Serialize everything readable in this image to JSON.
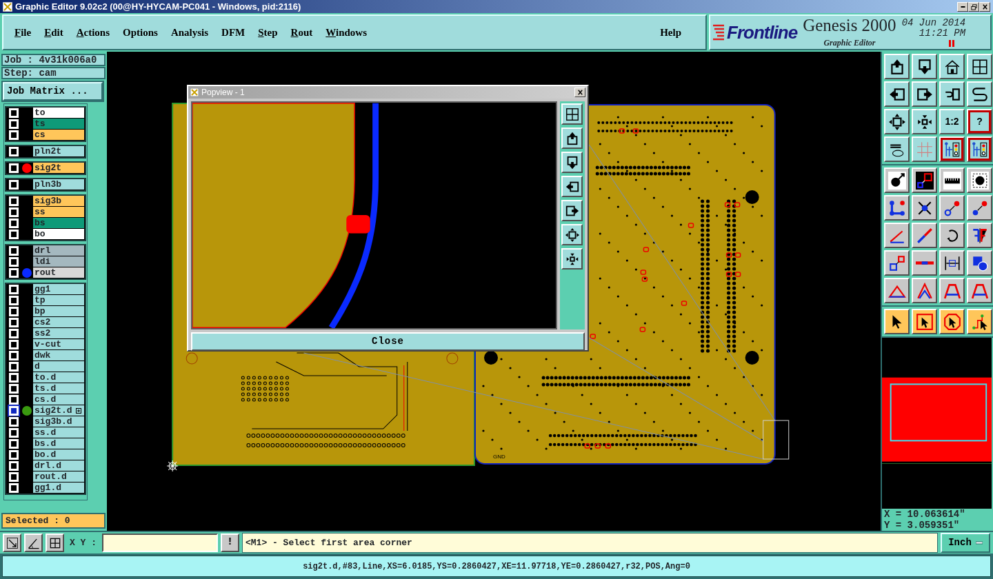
{
  "window": {
    "title": "Graphic Editor 9.02c2 (00@HY-HYCAM-PC041 - Windows, pid:2116)"
  },
  "menu": [
    {
      "label": "File",
      "underlined": true
    },
    {
      "label": "Edit",
      "underlined": true
    },
    {
      "label": "Actions",
      "underlined": true
    },
    {
      "label": "Options",
      "underlined": false
    },
    {
      "label": "Analysis",
      "underlined": false
    },
    {
      "label": "DFM",
      "underlined": false
    },
    {
      "label": "Step",
      "underlined": true
    },
    {
      "label": "Rout",
      "underlined": true
    },
    {
      "label": "Windows",
      "underlined": true
    }
  ],
  "help": "Help",
  "brand": {
    "logo": "Frontline",
    "product": "Genesis 2000",
    "module": "Graphic Editor",
    "date": "04 Jun 2014",
    "time": "11:21 PM"
  },
  "job": "Job : 4v31k006a0",
  "step": "Step: cam",
  "job_matrix": "Job Matrix ...",
  "layer_groups": [
    {
      "layers": [
        {
          "name": "to",
          "color": "#ffffff",
          "work": false
        },
        {
          "name": "ts",
          "color": "#0f9a78",
          "work": false
        },
        {
          "name": "cs",
          "color": "#ffc65a",
          "work": false
        }
      ]
    },
    {
      "layers": [
        {
          "name": "pln2t",
          "color": "#9fdcdc",
          "work": false
        }
      ]
    },
    {
      "layers": [
        {
          "name": "sig2t",
          "color": "#ffc65a",
          "work": false,
          "marker": {
            "color": "#ff0000"
          }
        }
      ]
    },
    {
      "layers": [
        {
          "name": "pln3b",
          "color": "#9fdcdc",
          "work": false
        }
      ]
    },
    {
      "layers": [
        {
          "name": "sig3b",
          "color": "#ffc65a",
          "work": false
        },
        {
          "name": "ss",
          "color": "#ffc65a",
          "work": false
        },
        {
          "name": "bs",
          "color": "#0f9a78",
          "work": false
        },
        {
          "name": "bo",
          "color": "#ffffff",
          "work": false
        }
      ]
    },
    {
      "layers": [
        {
          "name": "drl",
          "color": "#a4b8bf",
          "work": false
        },
        {
          "name": "ldi",
          "color": "#a4b8bf",
          "work": false
        },
        {
          "name": "rout",
          "color": "#d8d8d8",
          "work": false,
          "marker": {
            "color": "#0a2aff"
          }
        }
      ]
    },
    {
      "layers": [
        {
          "name": "gg1",
          "color": "#9fdcdc",
          "work": false
        },
        {
          "name": "tp",
          "color": "#9fdcdc",
          "work": false
        },
        {
          "name": "bp",
          "color": "#9fdcdc",
          "work": false
        },
        {
          "name": "cs2",
          "color": "#9fdcdc",
          "work": false
        },
        {
          "name": "ss2",
          "color": "#9fdcdc",
          "work": false
        },
        {
          "name": "v-cut",
          "color": "#9fdcdc",
          "work": false
        },
        {
          "name": "dwk",
          "color": "#9fdcdc",
          "work": false
        },
        {
          "name": "d",
          "color": "#9fdcdc",
          "work": false
        },
        {
          "name": "to.d",
          "color": "#9fdcdc",
          "work": false
        },
        {
          "name": "ts.d",
          "color": "#9fdcdc",
          "work": false
        },
        {
          "name": "cs.d",
          "color": "#9fdcdc",
          "work": false
        },
        {
          "name": "sig2t.d",
          "color": "#9fdcdc",
          "work": true,
          "marker": {
            "color": "#3a9a10"
          }
        },
        {
          "name": "sig3b.d",
          "color": "#9fdcdc",
          "work": false
        },
        {
          "name": "ss.d",
          "color": "#9fdcdc",
          "work": false
        },
        {
          "name": "bs.d",
          "color": "#9fdcdc",
          "work": false
        },
        {
          "name": "bo.d",
          "color": "#9fdcdc",
          "work": false
        },
        {
          "name": "drl.d",
          "color": "#9fdcdc",
          "work": false
        },
        {
          "name": "rout.d",
          "color": "#9fdcdc",
          "work": false
        },
        {
          "name": "gg1.d",
          "color": "#9fdcdc",
          "work": false
        }
      ]
    }
  ],
  "selected_count": "Selected : 0",
  "canvas": {
    "board_label": "GND"
  },
  "popview": {
    "title": "Popview - 1",
    "close": "Close",
    "tools": [
      {
        "kind": "window-grid"
      },
      {
        "kind": "up-box"
      },
      {
        "kind": "down-box"
      },
      {
        "kind": "left-box"
      },
      {
        "kind": "right-box"
      },
      {
        "kind": "expand"
      },
      {
        "kind": "shrink"
      }
    ]
  },
  "tool_sections": [
    {
      "buttons": [
        {
          "kind": "up-box",
          "highlighted": false
        },
        {
          "kind": "down-box",
          "highlighted": false
        },
        {
          "kind": "house",
          "highlighted": false
        },
        {
          "kind": "window-grid",
          "highlighted": false
        },
        {
          "kind": "left-box",
          "highlighted": false
        },
        {
          "kind": "right-box",
          "highlighted": false
        },
        {
          "kind": "undo-box",
          "highlighted": false
        },
        {
          "kind": "s-curve",
          "highlighted": false
        },
        {
          "kind": "expand",
          "highlighted": false
        },
        {
          "kind": "shrink",
          "highlighted": false
        },
        {
          "kind": "text",
          "label": "1:2",
          "highlighted": false
        },
        {
          "kind": "text",
          "label": "?",
          "highlighted": true
        },
        {
          "kind": "tools",
          "highlighted": false
        },
        {
          "kind": "grid",
          "highlighted": false
        },
        {
          "kind": "traffic",
          "highlighted": true
        },
        {
          "kind": "traffic",
          "highlighted": true
        }
      ]
    },
    {
      "buttons": [
        {
          "kind": "pad-arrow",
          "highlighted": false
        },
        {
          "kind": "line-box",
          "highlighted": false
        },
        {
          "kind": "ruler",
          "highlighted": false
        },
        {
          "kind": "dotted-pad",
          "highlighted": false
        },
        {
          "kind": "node-tree",
          "highlighted": false
        },
        {
          "kind": "cross-pad",
          "highlighted": false
        },
        {
          "kind": "pad-red",
          "highlighted": false
        },
        {
          "kind": "pad-blue",
          "highlighted": false
        },
        {
          "kind": "angle-line",
          "highlighted": false
        },
        {
          "kind": "diag-line",
          "highlighted": false
        },
        {
          "kind": "rotate",
          "highlighted": false
        },
        {
          "kind": "mirror",
          "highlighted": false
        },
        {
          "kind": "pad-squares",
          "highlighted": false
        },
        {
          "kind": "bar-line",
          "highlighted": false
        },
        {
          "kind": "dimension",
          "highlighted": false
        },
        {
          "kind": "circles",
          "highlighted": false
        },
        {
          "kind": "triangle",
          "highlighted": false
        },
        {
          "kind": "a-shape",
          "highlighted": false
        },
        {
          "kind": "a-flat",
          "highlighted": false
        },
        {
          "kind": "a-flat",
          "highlighted": false
        }
      ]
    },
    {
      "buttons": [
        {
          "kind": "pointer",
          "highlighted": false
        },
        {
          "kind": "pointer-box",
          "highlighted": false
        },
        {
          "kind": "pointer-oct",
          "highlighted": false
        },
        {
          "kind": "pointer-path",
          "highlighted": false
        }
      ]
    }
  ],
  "coordinates": [
    "X = 10.063614\"",
    "Y = 3.059351\""
  ],
  "bottom_tools": [
    {
      "kind": "arrow-diag"
    },
    {
      "kind": "angle-measure"
    },
    {
      "kind": "grid-cross"
    }
  ],
  "xy_label": "X Y :",
  "alert": "!",
  "prompt": "<M1> - Select first area corner",
  "units": "Inch",
  "status": "sig2t.d,#83,Line,XS=6.0185,YS=0.2860427,XE=11.97718,YE=0.2860427,r32,POS,Ang=0"
}
